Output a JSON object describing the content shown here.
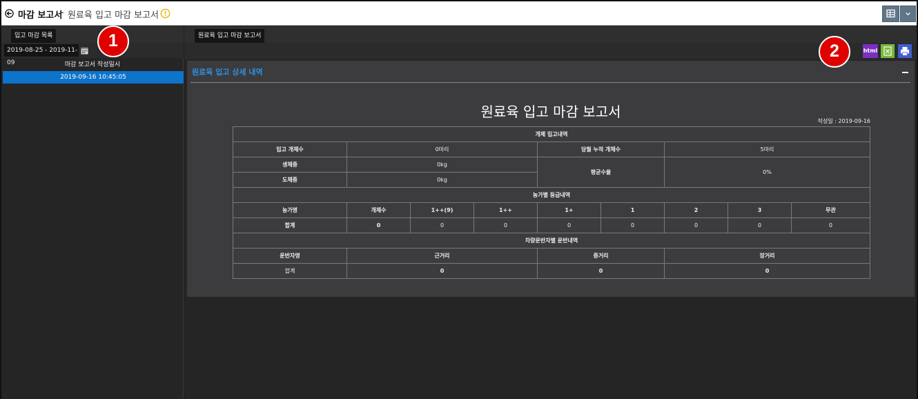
{
  "header": {
    "title_main": "마감 보고서",
    "title_separator": "-",
    "title_sub": "원료육 입고 마감 보고서"
  },
  "left_panel": {
    "tab_label": "입고 마감 목록",
    "date_range": "2019-08-25 - 2019-11-09",
    "list_header": "마감 보고서 작성일시",
    "items": [
      "2019-09-16 10:45:05"
    ]
  },
  "right_panel": {
    "tab_label": "원료육 입고 마감 보고서",
    "html_button": "html",
    "section_title": "원료육 입고 상세 내역"
  },
  "report": {
    "title": "원료육 입고 마감 보고서",
    "date": "작성일 : 2019-09-16",
    "section1": {
      "title": "개체 입고내역",
      "label_count": "입고 개체수",
      "count": "0마리",
      "label_cumulative": "당월 누적 개체수",
      "cumulative": "5마리",
      "label_live_weight": "생체중",
      "live_weight": "0kg",
      "label_avg_yield": "평균수율",
      "avg_yield": "0%",
      "label_carcass_weight": "도체중",
      "carcass_weight": "0kg"
    },
    "section2": {
      "title": "농가별 등급내역",
      "headers": [
        "농가명",
        "개체수",
        "1++(9)",
        "1++",
        "1+",
        "1",
        "2",
        "3",
        "무관"
      ],
      "total_row": [
        "합계",
        "0",
        "0",
        "0",
        "0",
        "0",
        "0",
        "0",
        "0"
      ]
    },
    "section3": {
      "title": "차량운반자별 운반내역",
      "headers": [
        "운반자명",
        "근거리",
        "중거리",
        "장거리"
      ],
      "total_row": [
        "합계",
        "0",
        "0",
        "0"
      ]
    }
  },
  "annotations": [
    "1",
    "2"
  ],
  "colors": {
    "accent": "#0d74cc",
    "section_title": "#2f8fe0",
    "html_button": "#7b2fbf",
    "excel_button": "#79b83b",
    "print_button": "#3f5ed0",
    "annotation": "#e00000"
  }
}
